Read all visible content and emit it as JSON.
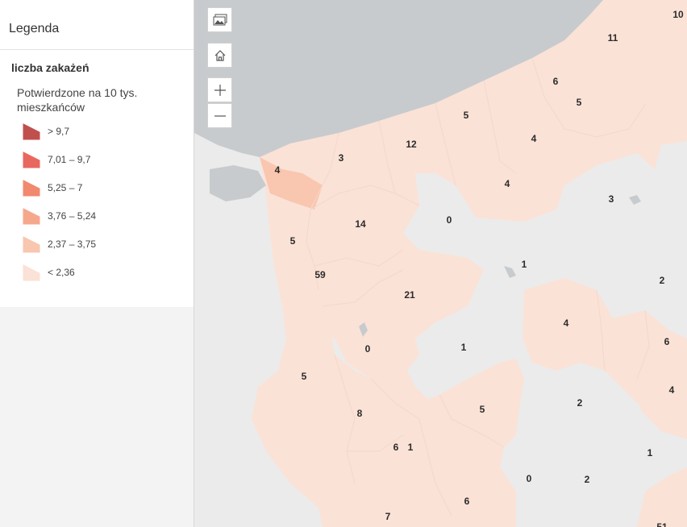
{
  "legend": {
    "title": "Legenda",
    "layer_title": "liczba zakażeń",
    "field_title": "Potwierdzone na 10 tys. mieszkańców",
    "items": [
      {
        "label": "> 9,7",
        "color": "#c0504d"
      },
      {
        "label": "7,01 – 9,7",
        "color": "#e8685f"
      },
      {
        "label": "5,25 – 7",
        "color": "#f1896e"
      },
      {
        "label": "3,76 – 5,24",
        "color": "#f6a88c"
      },
      {
        "label": "2,37 – 3,75",
        "color": "#f9c6b0"
      },
      {
        "label": "< 2,36",
        "color": "#fbe2d6"
      }
    ]
  },
  "map_controls": {
    "basemap_icon": "image-gallery-icon",
    "home_icon": "home-icon",
    "zoom_in_icon": "plus-icon",
    "zoom_out_icon": "minus-icon"
  },
  "map_colors": {
    "water": "#c8cbcd",
    "land": "#ebebeb",
    "class_lowest": "#fbe2d6",
    "class_second": "#f9c6b0"
  },
  "region_labels": [
    "10",
    "11",
    "6",
    "5",
    "5",
    "4",
    "12",
    "3",
    "4",
    "4",
    "0",
    "3",
    "14",
    "5",
    "1",
    "59",
    "2",
    "21",
    "4",
    "6",
    "0",
    "1",
    "5",
    "2",
    "4",
    "8",
    "5",
    "6",
    "1",
    "1",
    "0",
    "2",
    "7",
    "6",
    "51"
  ]
}
